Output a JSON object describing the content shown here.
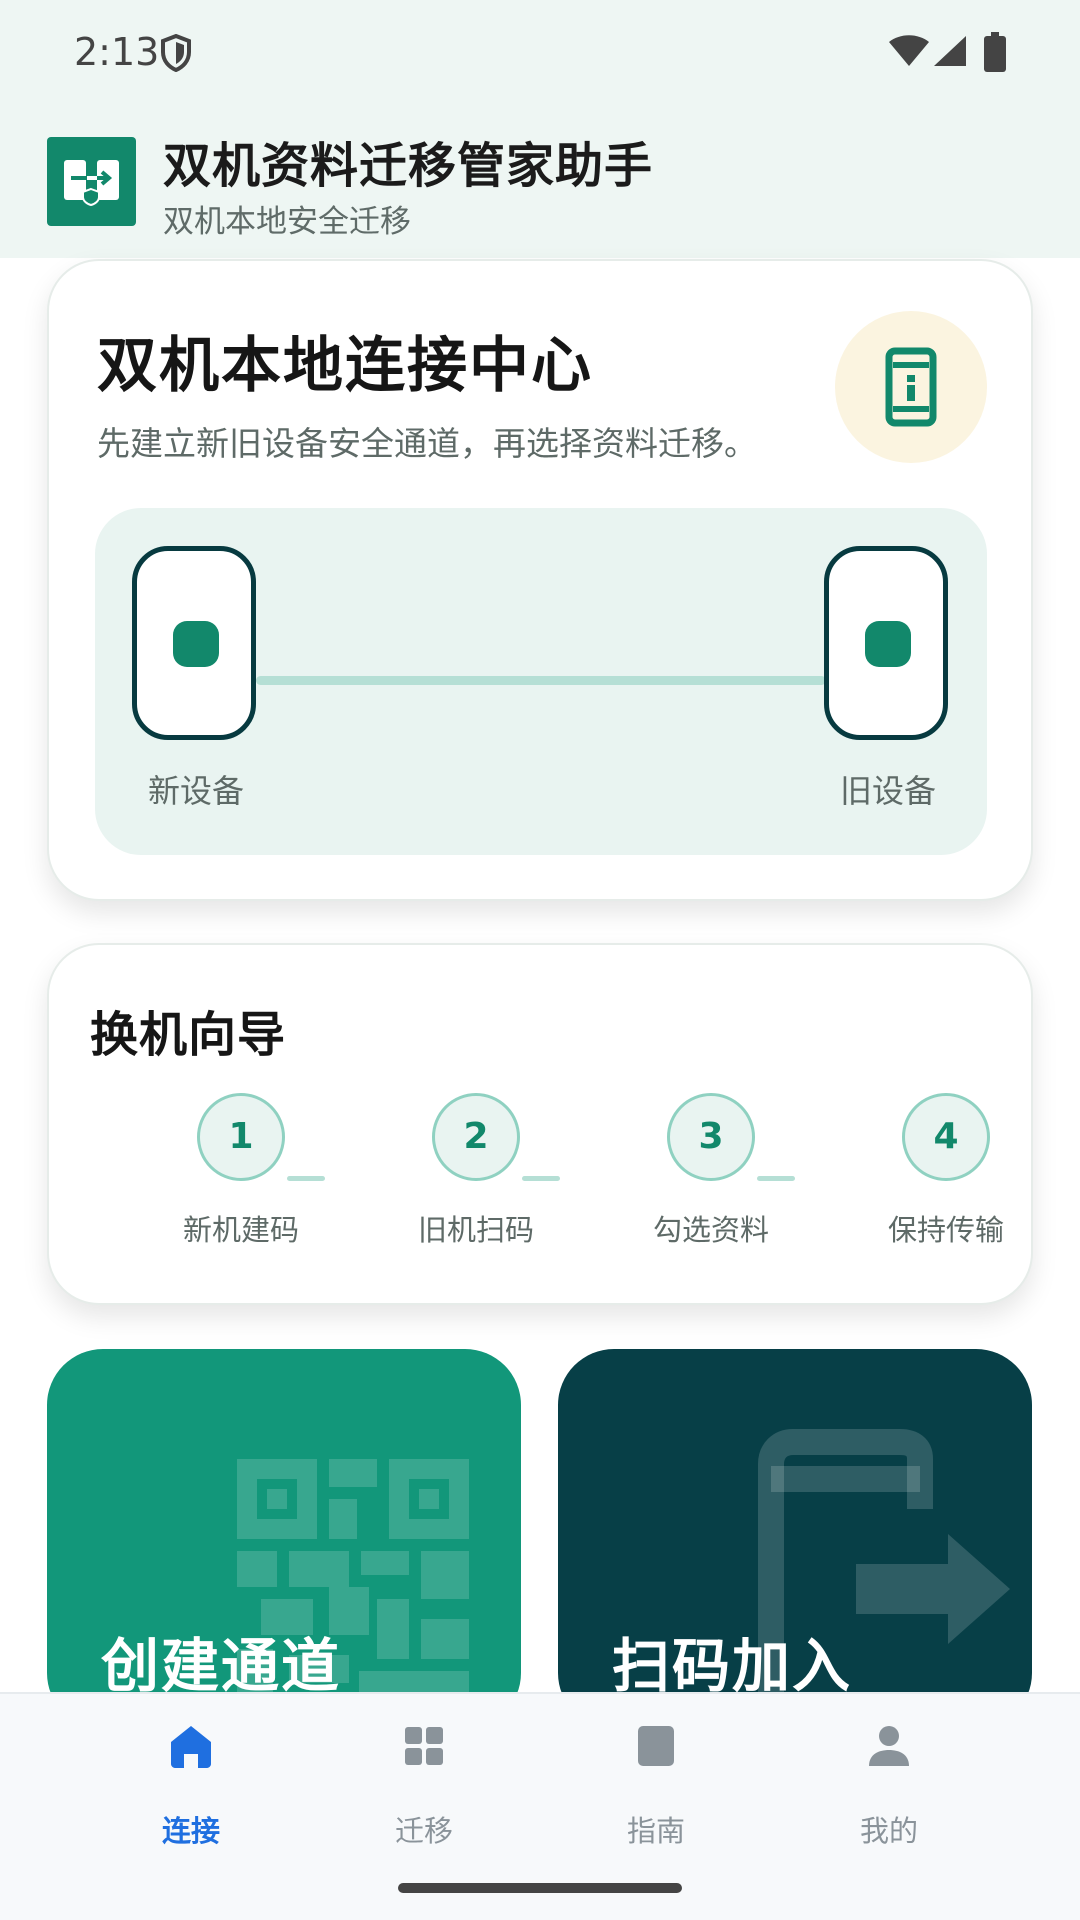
{
  "status_bar": {
    "time": "2:13",
    "icons": [
      "shield-icon",
      "wifi-icon",
      "signal-icon",
      "battery-icon"
    ]
  },
  "app_header": {
    "title": "双机资料迁移管家助手",
    "subtitle": "双机本地安全迁移",
    "logo_icon": "transfer-logo-icon"
  },
  "connection_card": {
    "title": "双机本地连接中心",
    "description": "先建立新旧设备安全通道，再选择资料迁移。",
    "badge_icon": "phone-info-icon",
    "new_device_label": "新设备",
    "old_device_label": "旧设备"
  },
  "guide": {
    "title": "换机向导",
    "steps": [
      {
        "number": "1",
        "label": "新机建码"
      },
      {
        "number": "2",
        "label": "旧机扫码"
      },
      {
        "number": "3",
        "label": "勾选资料"
      },
      {
        "number": "4",
        "label": "保持传输"
      }
    ]
  },
  "actions": {
    "create_label": "创建通道",
    "create_icon": "qr-code-icon",
    "scan_label": "扫码加入",
    "scan_icon": "phone-export-icon"
  },
  "bottom_nav": {
    "items": [
      {
        "label": "连接",
        "icon": "home-icon",
        "active": true
      },
      {
        "label": "迁移",
        "icon": "grid-icon",
        "active": false
      },
      {
        "label": "指南",
        "icon": "book-icon",
        "active": false
      },
      {
        "label": "我的",
        "icon": "person-icon",
        "active": false
      }
    ]
  },
  "colors": {
    "primary": "#12886b",
    "dark_teal": "#073f47",
    "nav_active": "#1f6fe0",
    "header_bg": "#eef6f3"
  }
}
